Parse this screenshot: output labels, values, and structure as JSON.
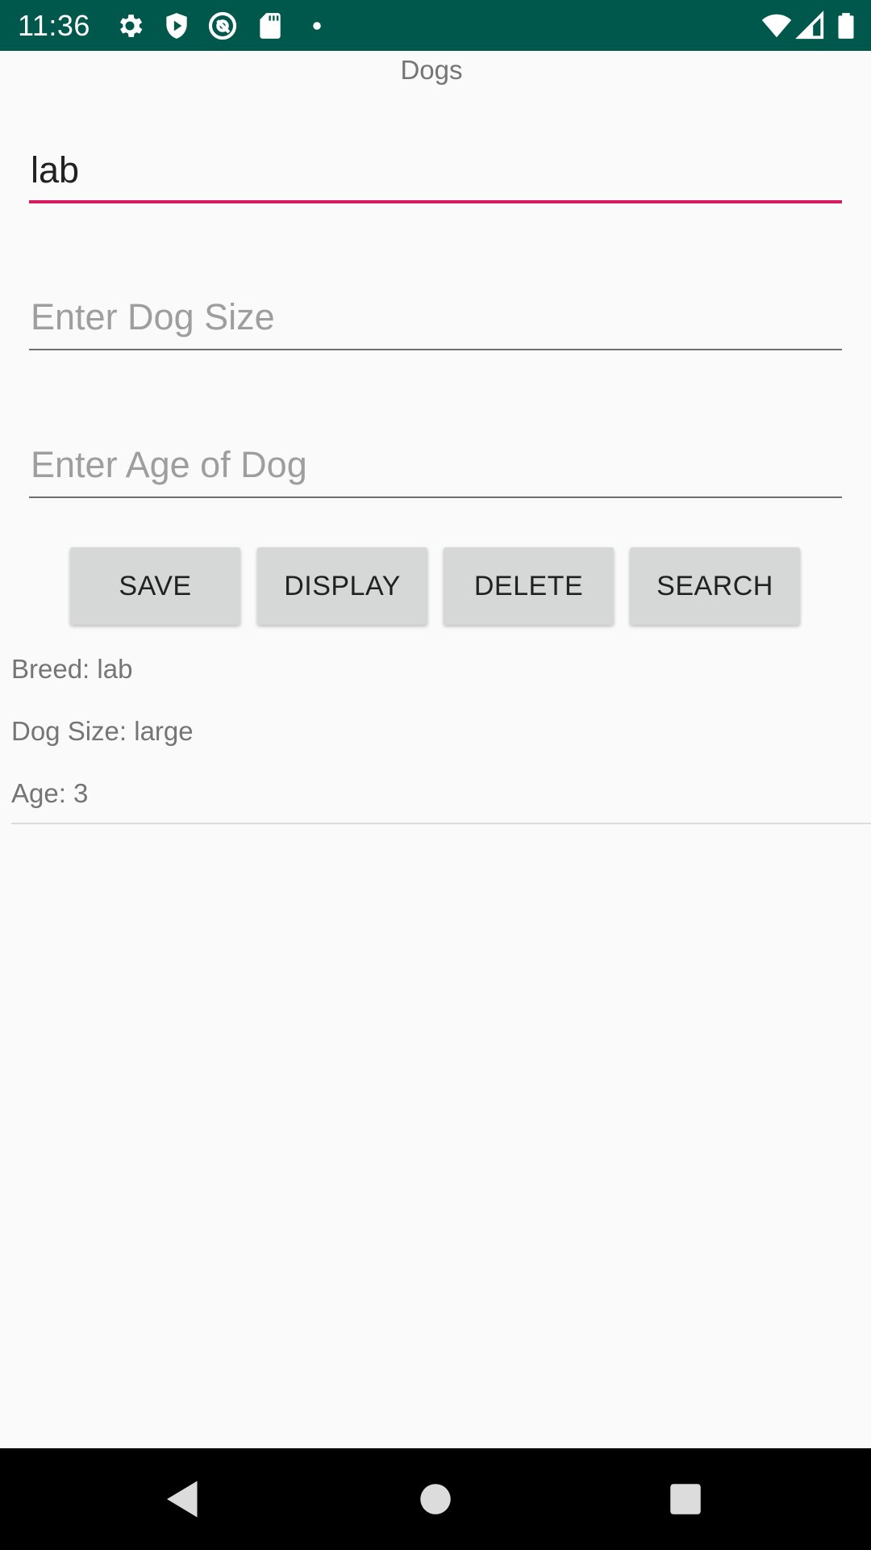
{
  "status_bar": {
    "time": "11:36",
    "icons": [
      "gear-icon",
      "shield-icon",
      "at-sign-icon",
      "sd-card-icon",
      "notification-dot-icon",
      "wifi-icon",
      "cellular-signal-icon",
      "battery-icon"
    ],
    "color": "#00574b"
  },
  "app": {
    "title": "Dogs",
    "accent_color": "#d81b60"
  },
  "form": {
    "breed_value": "lab",
    "size_placeholder": "Enter Dog Size",
    "size_value": "",
    "age_placeholder": "Enter Age of Dog",
    "age_value": ""
  },
  "buttons": {
    "save": "SAVE",
    "display": "DISPLAY",
    "delete": "DELETE",
    "search": "SEARCH"
  },
  "results": {
    "breed": "Breed: lab",
    "size": "Dog Size: large",
    "age": "Age: 3"
  },
  "nav_bar": {
    "icons": [
      "back-icon",
      "home-icon",
      "recents-icon"
    ]
  }
}
